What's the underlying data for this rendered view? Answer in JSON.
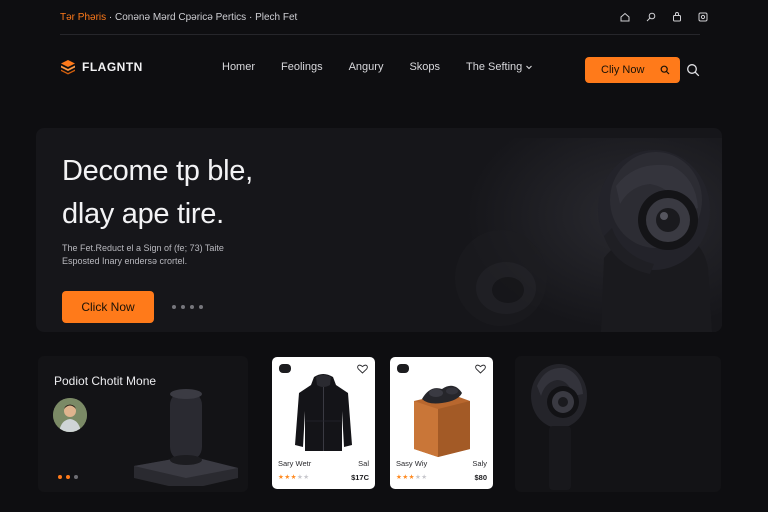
{
  "topbar": {
    "promo_highlight": "Tər Phəris",
    "promo_separator": " · ",
    "promo_text": "Conənə Mərd Cpəricə Pertics · Plech Fet",
    "icons": [
      "home-icon",
      "search-icon",
      "bag-icon",
      "cart-icon"
    ]
  },
  "nav": {
    "brand": "FLAGNTN",
    "items": [
      {
        "label": "Homer"
      },
      {
        "label": "Feolings"
      },
      {
        "label": "Angury"
      },
      {
        "label": "Skops"
      },
      {
        "label": "The Sefting"
      }
    ],
    "cta_label": "Cliy Now"
  },
  "hero": {
    "headline_line1": "Decome tp ble,",
    "headline_line2": "dlay ape tire.",
    "subtext_line1": "The Fet.Reduct el a Sign of (fe; 73) Taite",
    "subtext_line2": "Esposted Inary endersə crortel.",
    "button_label": "Click Now",
    "slide_count": 4
  },
  "featured": {
    "title": "Podiot Chotit Mone",
    "dots_total": 3,
    "dots_active": 2
  },
  "products": [
    {
      "name": "Sary Wetr",
      "price_small": "Sal",
      "price": "$17C",
      "rating": 3
    },
    {
      "name": "Sasy Wiy",
      "price_small": "Saly",
      "price": "$80",
      "rating": 3
    }
  ],
  "colors": {
    "accent": "#ff7a1a",
    "background": "#0e0e11",
    "card_dark": "#131316",
    "card_light": "#ffffff"
  }
}
